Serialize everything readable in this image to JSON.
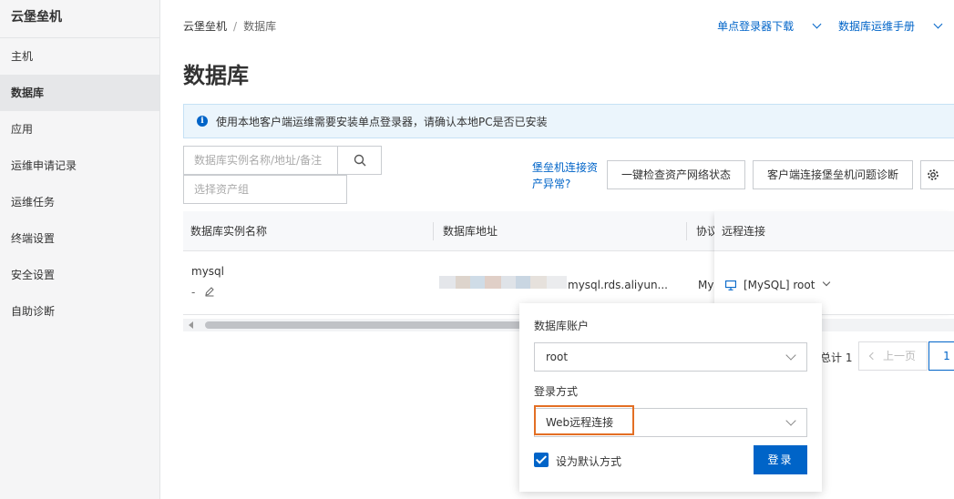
{
  "sidebar": {
    "brand": "云堡垒机",
    "items": [
      {
        "label": "主机",
        "active": false
      },
      {
        "label": "数据库",
        "active": true
      },
      {
        "label": "应用",
        "active": false
      },
      {
        "label": "运维申请记录",
        "active": false
      },
      {
        "label": "运维任务",
        "active": false
      },
      {
        "label": "终端设置",
        "active": false
      },
      {
        "label": "安全设置",
        "active": false
      },
      {
        "label": "自助诊断",
        "active": false
      }
    ]
  },
  "header": {
    "breadcrumb": [
      "云堡垒机",
      "数据库"
    ],
    "breadcrumb_sep": "/",
    "links": [
      "单点登录器下载",
      "数据库运维手册"
    ],
    "title": "数据库"
  },
  "notice": {
    "icon": "info-icon",
    "text": "使用本地客户端运维需要安装单点登录器，请确认本地PC是否已安装"
  },
  "toolbar": {
    "search_placeholder": "数据库实例名称/地址/备注",
    "group_placeholder": "选择资产组",
    "conn_link": "堡垒机连接资产异常?",
    "check_button": "一键检查资产网络状态",
    "diag_button": "客户端连接堡垒机问题诊断"
  },
  "table": {
    "columns": [
      "数据库实例名称",
      "数据库地址",
      "协议",
      "远程连接"
    ],
    "rows": [
      {
        "name": "mysql",
        "remark": "-",
        "address_suffix": "mysql.rds.aliyun...",
        "protocol": "MyS",
        "connect": "[MySQL] root"
      }
    ]
  },
  "pagination": {
    "total_label": "总计 1",
    "prev": "上一页",
    "current": "1"
  },
  "popover": {
    "account_label": "数据库账户",
    "account_value": "root",
    "method_label": "登录方式",
    "method_value": "Web远程连接",
    "default_label": "设为默认方式",
    "default_checked": true,
    "login_button": "登录"
  },
  "colors": {
    "accent": "#0064c8",
    "highlight": "#e36f24"
  }
}
